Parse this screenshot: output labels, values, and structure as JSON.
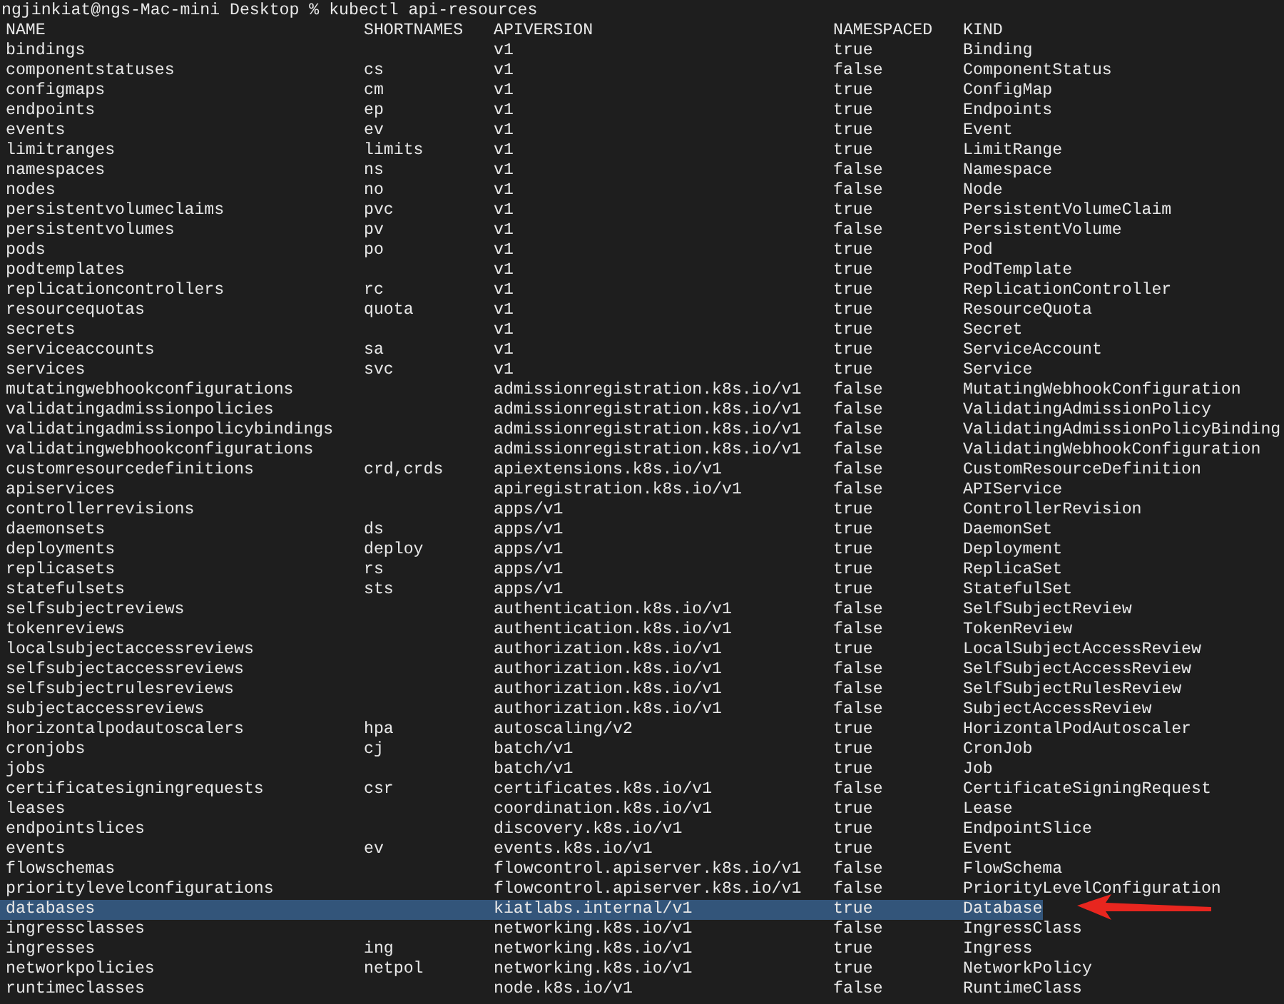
{
  "prompt": "ngjinkiat@ngs-Mac-mini Desktop % kubectl api-resources",
  "columns": [
    "NAME",
    "SHORTNAMES",
    "APIVERSION",
    "NAMESPACED",
    "KIND"
  ],
  "rows": [
    {
      "name": "bindings",
      "apiversion": "v1",
      "namespaced": "true",
      "kind": "Binding",
      "selected": false
    },
    {
      "name": "componentstatuses",
      "shortnames": "cs",
      "apiversion": "v1",
      "namespaced": "false",
      "kind": "ComponentStatus",
      "selected": false
    },
    {
      "name": "configmaps",
      "shortnames": "cm",
      "apiversion": "v1",
      "namespaced": "true",
      "kind": "ConfigMap",
      "selected": false
    },
    {
      "name": "endpoints",
      "shortnames": "ep",
      "apiversion": "v1",
      "namespaced": "true",
      "kind": "Endpoints",
      "selected": false
    },
    {
      "name": "events",
      "shortnames": "ev",
      "apiversion": "v1",
      "namespaced": "true",
      "kind": "Event",
      "selected": false
    },
    {
      "name": "limitranges",
      "shortnames": "limits",
      "apiversion": "v1",
      "namespaced": "true",
      "kind": "LimitRange",
      "selected": false
    },
    {
      "name": "namespaces",
      "shortnames": "ns",
      "apiversion": "v1",
      "namespaced": "false",
      "kind": "Namespace",
      "selected": false
    },
    {
      "name": "nodes",
      "shortnames": "no",
      "apiversion": "v1",
      "namespaced": "false",
      "kind": "Node",
      "selected": false
    },
    {
      "name": "persistentvolumeclaims",
      "shortnames": "pvc",
      "apiversion": "v1",
      "namespaced": "true",
      "kind": "PersistentVolumeClaim",
      "selected": false
    },
    {
      "name": "persistentvolumes",
      "shortnames": "pv",
      "apiversion": "v1",
      "namespaced": "false",
      "kind": "PersistentVolume",
      "selected": false
    },
    {
      "name": "pods",
      "shortnames": "po",
      "apiversion": "v1",
      "namespaced": "true",
      "kind": "Pod",
      "selected": false
    },
    {
      "name": "podtemplates",
      "apiversion": "v1",
      "namespaced": "true",
      "kind": "PodTemplate",
      "selected": false
    },
    {
      "name": "replicationcontrollers",
      "shortnames": "rc",
      "apiversion": "v1",
      "namespaced": "true",
      "kind": "ReplicationController",
      "selected": false
    },
    {
      "name": "resourcequotas",
      "shortnames": "quota",
      "apiversion": "v1",
      "namespaced": "true",
      "kind": "ResourceQuota",
      "selected": false
    },
    {
      "name": "secrets",
      "apiversion": "v1",
      "namespaced": "true",
      "kind": "Secret",
      "selected": false
    },
    {
      "name": "serviceaccounts",
      "shortnames": "sa",
      "apiversion": "v1",
      "namespaced": "true",
      "kind": "ServiceAccount",
      "selected": false
    },
    {
      "name": "services",
      "shortnames": "svc",
      "apiversion": "v1",
      "namespaced": "true",
      "kind": "Service",
      "selected": false
    },
    {
      "name": "mutatingwebhookconfigurations",
      "apiversion": "admissionregistration.k8s.io/v1",
      "namespaced": "false",
      "kind": "MutatingWebhookConfiguration",
      "selected": false
    },
    {
      "name": "validatingadmissionpolicies",
      "apiversion": "admissionregistration.k8s.io/v1",
      "namespaced": "false",
      "kind": "ValidatingAdmissionPolicy",
      "selected": false
    },
    {
      "name": "validatingadmissionpolicybindings",
      "apiversion": "admissionregistration.k8s.io/v1",
      "namespaced": "false",
      "kind": "ValidatingAdmissionPolicyBinding",
      "selected": false
    },
    {
      "name": "validatingwebhookconfigurations",
      "apiversion": "admissionregistration.k8s.io/v1",
      "namespaced": "false",
      "kind": "ValidatingWebhookConfiguration",
      "selected": false
    },
    {
      "name": "customresourcedefinitions",
      "shortnames": "crd,crds",
      "apiversion": "apiextensions.k8s.io/v1",
      "namespaced": "false",
      "kind": "CustomResourceDefinition",
      "selected": false
    },
    {
      "name": "apiservices",
      "apiversion": "apiregistration.k8s.io/v1",
      "namespaced": "false",
      "kind": "APIService",
      "selected": false
    },
    {
      "name": "controllerrevisions",
      "apiversion": "apps/v1",
      "namespaced": "true",
      "kind": "ControllerRevision",
      "selected": false
    },
    {
      "name": "daemonsets",
      "shortnames": "ds",
      "apiversion": "apps/v1",
      "namespaced": "true",
      "kind": "DaemonSet",
      "selected": false
    },
    {
      "name": "deployments",
      "shortnames": "deploy",
      "apiversion": "apps/v1",
      "namespaced": "true",
      "kind": "Deployment",
      "selected": false
    },
    {
      "name": "replicasets",
      "shortnames": "rs",
      "apiversion": "apps/v1",
      "namespaced": "true",
      "kind": "ReplicaSet",
      "selected": false
    },
    {
      "name": "statefulsets",
      "shortnames": "sts",
      "apiversion": "apps/v1",
      "namespaced": "true",
      "kind": "StatefulSet",
      "selected": false
    },
    {
      "name": "selfsubjectreviews",
      "apiversion": "authentication.k8s.io/v1",
      "namespaced": "false",
      "kind": "SelfSubjectReview",
      "selected": false
    },
    {
      "name": "tokenreviews",
      "apiversion": "authentication.k8s.io/v1",
      "namespaced": "false",
      "kind": "TokenReview",
      "selected": false
    },
    {
      "name": "localsubjectaccessreviews",
      "apiversion": "authorization.k8s.io/v1",
      "namespaced": "true",
      "kind": "LocalSubjectAccessReview",
      "selected": false
    },
    {
      "name": "selfsubjectaccessreviews",
      "apiversion": "authorization.k8s.io/v1",
      "namespaced": "false",
      "kind": "SelfSubjectAccessReview",
      "selected": false
    },
    {
      "name": "selfsubjectrulesreviews",
      "apiversion": "authorization.k8s.io/v1",
      "namespaced": "false",
      "kind": "SelfSubjectRulesReview",
      "selected": false
    },
    {
      "name": "subjectaccessreviews",
      "apiversion": "authorization.k8s.io/v1",
      "namespaced": "false",
      "kind": "SubjectAccessReview",
      "selected": false
    },
    {
      "name": "horizontalpodautoscalers",
      "shortnames": "hpa",
      "apiversion": "autoscaling/v2",
      "namespaced": "true",
      "kind": "HorizontalPodAutoscaler",
      "selected": false
    },
    {
      "name": "cronjobs",
      "shortnames": "cj",
      "apiversion": "batch/v1",
      "namespaced": "true",
      "kind": "CronJob",
      "selected": false
    },
    {
      "name": "jobs",
      "apiversion": "batch/v1",
      "namespaced": "true",
      "kind": "Job",
      "selected": false
    },
    {
      "name": "certificatesigningrequests",
      "shortnames": "csr",
      "apiversion": "certificates.k8s.io/v1",
      "namespaced": "false",
      "kind": "CertificateSigningRequest",
      "selected": false
    },
    {
      "name": "leases",
      "apiversion": "coordination.k8s.io/v1",
      "namespaced": "true",
      "kind": "Lease",
      "selected": false
    },
    {
      "name": "endpointslices",
      "apiversion": "discovery.k8s.io/v1",
      "namespaced": "true",
      "kind": "EndpointSlice",
      "selected": false
    },
    {
      "name": "events",
      "shortnames": "ev",
      "apiversion": "events.k8s.io/v1",
      "namespaced": "true",
      "kind": "Event",
      "selected": false
    },
    {
      "name": "flowschemas",
      "apiversion": "flowcontrol.apiserver.k8s.io/v1",
      "namespaced": "false",
      "kind": "FlowSchema",
      "selected": false
    },
    {
      "name": "prioritylevelconfigurations",
      "apiversion": "flowcontrol.apiserver.k8s.io/v1",
      "namespaced": "false",
      "kind": "PriorityLevelConfiguration",
      "selected": false
    },
    {
      "name": "databases",
      "apiversion": "kiatlabs.internal/v1",
      "namespaced": "true",
      "kind": "Database",
      "selected": true
    },
    {
      "name": "ingressclasses",
      "apiversion": "networking.k8s.io/v1",
      "namespaced": "false",
      "kind": "IngressClass",
      "selected": false
    },
    {
      "name": "ingresses",
      "shortnames": "ing",
      "apiversion": "networking.k8s.io/v1",
      "namespaced": "true",
      "kind": "Ingress",
      "selected": false
    },
    {
      "name": "networkpolicies",
      "shortnames": "netpol",
      "apiversion": "networking.k8s.io/v1",
      "namespaced": "true",
      "kind": "NetworkPolicy",
      "selected": false
    },
    {
      "name": "runtimeclasses",
      "apiversion": "node.k8s.io/v1",
      "namespaced": "false",
      "kind": "RuntimeClass",
      "selected": false
    }
  ]
}
